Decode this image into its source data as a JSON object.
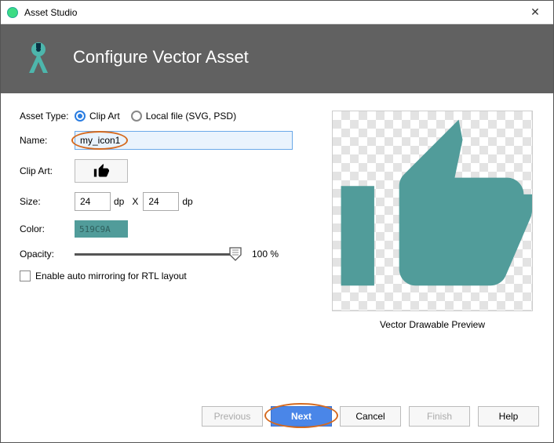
{
  "window": {
    "title": "Asset Studio"
  },
  "header": {
    "title": "Configure Vector Asset"
  },
  "form": {
    "asset_type_label": "Asset Type:",
    "radio_clip_art": "Clip Art",
    "radio_local_file": "Local file (SVG, PSD)",
    "name_label": "Name:",
    "name_value": "my_icon1",
    "clip_art_label": "Clip Art:",
    "size_label": "Size:",
    "size_w": "24",
    "size_h": "24",
    "size_dp": "dp",
    "size_x": "X",
    "color_label": "Color:",
    "color_hex": "519C9A",
    "opacity_label": "Opacity:",
    "opacity_value": "100 %",
    "rtl_label": "Enable auto mirroring for RTL layout"
  },
  "preview": {
    "caption": "Vector Drawable Preview"
  },
  "footer": {
    "previous": "Previous",
    "next": "Next",
    "cancel": "Cancel",
    "finish": "Finish",
    "help": "Help"
  },
  "colors": {
    "accent": "#519C9A",
    "primary_btn": "#4a86e8"
  }
}
